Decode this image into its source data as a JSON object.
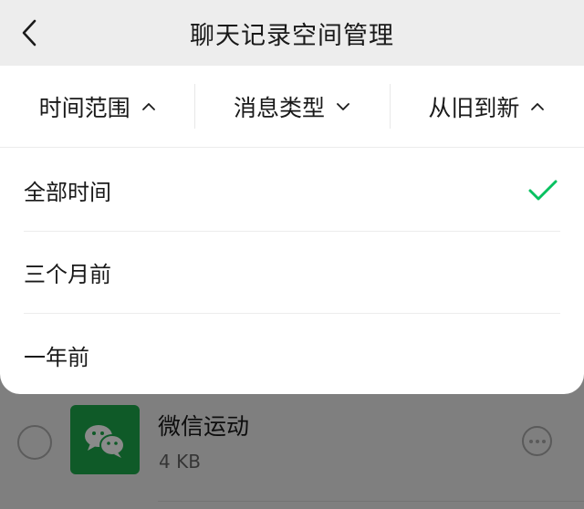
{
  "header": {
    "title": "聊天记录空间管理",
    "back_icon": "chevron-left-icon"
  },
  "filters": [
    {
      "label": "时间范围",
      "icon": "chevron-up-icon",
      "expanded": true
    },
    {
      "label": "消息类型",
      "icon": "chevron-down-icon",
      "expanded": false
    },
    {
      "label": "从旧到新",
      "icon": "chevron-up-icon",
      "expanded": false
    }
  ],
  "time_range_options": [
    {
      "label": "全部时间",
      "selected": true
    },
    {
      "label": "三个月前",
      "selected": false
    },
    {
      "label": "一年前",
      "selected": false
    }
  ],
  "list": [
    {
      "name": "微信运动",
      "size": "4 KB",
      "icon": "wechat-chat-icon",
      "more_icon": "more-options-icon"
    }
  ],
  "colors": {
    "check_green": "#07c160",
    "app_icon_bg": "#0f5a28",
    "overlay": "#7f7f7f"
  }
}
